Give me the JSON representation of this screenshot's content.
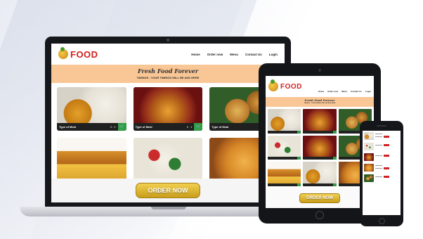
{
  "brand": {
    "name": "FOOD"
  },
  "nav": [
    "Home",
    "Order now",
    "Menu",
    "Contact Us",
    "Login"
  ],
  "hero": {
    "title": "Fresh Food Forever",
    "subtitle": "TIMINGS : YOUR TIMINGS WILL BE ADD HERE"
  },
  "cards": [
    {
      "label": "Type of Meal",
      "qty": "0",
      "count": "1"
    },
    {
      "label": "Type of Meal",
      "qty": "0",
      "count": "1"
    },
    {
      "label": "Type of Meal",
      "qty": "0",
      "count": "1"
    }
  ],
  "cta": {
    "label": "ORDER NOW"
  },
  "colors": {
    "brand": "#d21f1f",
    "hero_bg": "#f9c696",
    "cart": "#2f9e44",
    "cta": "#e0b836"
  }
}
